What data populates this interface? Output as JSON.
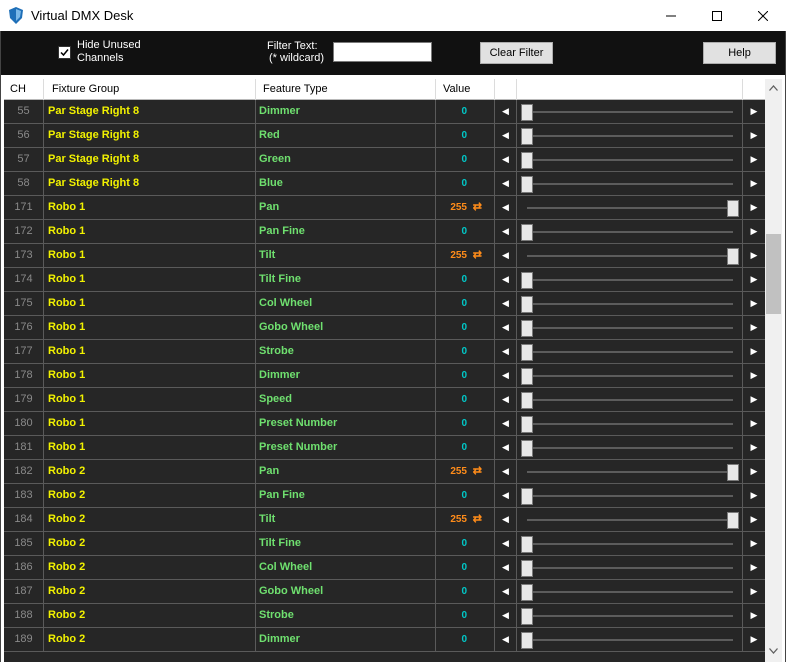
{
  "window": {
    "title": "Virtual DMX Desk",
    "app_icon": "shield-logo-icon",
    "controls": [
      "minimize-icon",
      "maximize-icon",
      "close-icon"
    ]
  },
  "toolbar": {
    "hide_unused_label": "Hide Unused Channels",
    "hide_unused_checked": true,
    "filter_label": "Filter Text:\n(* wildcard)",
    "filter_value": "",
    "clear_filter_label": "Clear Filter",
    "help_label": "Help"
  },
  "grid": {
    "columns": [
      "CH",
      "Fixture Group",
      "Feature Type",
      "Value"
    ],
    "colors": {
      "channel": "#8a8a8a",
      "fixture": "#f2f200",
      "feature": "#6fe06f",
      "value_zero": "#00c8c8",
      "value_full": "#ff8c1a",
      "background": "#262626"
    },
    "rows": [
      {
        "ch": "55",
        "fixture": "Par Stage Right 8",
        "feature": "Dimmer",
        "value": "0",
        "level": 0,
        "toggle": ""
      },
      {
        "ch": "56",
        "fixture": "Par Stage Right 8",
        "feature": "Red",
        "value": "0",
        "level": 0,
        "toggle": ""
      },
      {
        "ch": "57",
        "fixture": "Par Stage Right 8",
        "feature": "Green",
        "value": "0",
        "level": 0,
        "toggle": ""
      },
      {
        "ch": "58",
        "fixture": "Par Stage Right 8",
        "feature": "Blue",
        "value": "0",
        "level": 0,
        "toggle": ""
      },
      {
        "ch": "171",
        "fixture": "Robo 1",
        "feature": "Pan",
        "value": "255",
        "level": 1,
        "toggle": "⇄"
      },
      {
        "ch": "172",
        "fixture": "Robo 1",
        "feature": "Pan Fine",
        "value": "0",
        "level": 0,
        "toggle": ""
      },
      {
        "ch": "173",
        "fixture": "Robo 1",
        "feature": "Tilt",
        "value": "255",
        "level": 1,
        "toggle": "⇄"
      },
      {
        "ch": "174",
        "fixture": "Robo 1",
        "feature": "Tilt Fine",
        "value": "0",
        "level": 0,
        "toggle": ""
      },
      {
        "ch": "175",
        "fixture": "Robo 1",
        "feature": "Col Wheel",
        "value": "0",
        "level": 0,
        "toggle": ""
      },
      {
        "ch": "176",
        "fixture": "Robo 1",
        "feature": "Gobo Wheel",
        "value": "0",
        "level": 0,
        "toggle": ""
      },
      {
        "ch": "177",
        "fixture": "Robo 1",
        "feature": "Strobe",
        "value": "0",
        "level": 0,
        "toggle": ""
      },
      {
        "ch": "178",
        "fixture": "Robo 1",
        "feature": "Dimmer",
        "value": "0",
        "level": 0,
        "toggle": ""
      },
      {
        "ch": "179",
        "fixture": "Robo 1",
        "feature": "Speed",
        "value": "0",
        "level": 0,
        "toggle": ""
      },
      {
        "ch": "180",
        "fixture": "Robo 1",
        "feature": "Preset Number",
        "value": "0",
        "level": 0,
        "toggle": ""
      },
      {
        "ch": "181",
        "fixture": "Robo 1",
        "feature": "Preset Number",
        "value": "0",
        "level": 0,
        "toggle": ""
      },
      {
        "ch": "182",
        "fixture": "Robo 2",
        "feature": "Pan",
        "value": "255",
        "level": 1,
        "toggle": "⇄"
      },
      {
        "ch": "183",
        "fixture": "Robo 2",
        "feature": "Pan Fine",
        "value": "0",
        "level": 0,
        "toggle": ""
      },
      {
        "ch": "184",
        "fixture": "Robo 2",
        "feature": "Tilt",
        "value": "255",
        "level": 1,
        "toggle": "⇄"
      },
      {
        "ch": "185",
        "fixture": "Robo 2",
        "feature": "Tilt Fine",
        "value": "0",
        "level": 0,
        "toggle": ""
      },
      {
        "ch": "186",
        "fixture": "Robo 2",
        "feature": "Col Wheel",
        "value": "0",
        "level": 0,
        "toggle": ""
      },
      {
        "ch": "187",
        "fixture": "Robo 2",
        "feature": "Gobo Wheel",
        "value": "0",
        "level": 0,
        "toggle": ""
      },
      {
        "ch": "188",
        "fixture": "Robo 2",
        "feature": "Strobe",
        "value": "0",
        "level": 0,
        "toggle": ""
      },
      {
        "ch": "189",
        "fixture": "Robo 2",
        "feature": "Dimmer",
        "value": "0",
        "level": 0,
        "toggle": ""
      }
    ]
  },
  "scrollbar": {
    "up_icon": "scroll-up-arrow-icon",
    "down_icon": "scroll-down-arrow-icon"
  }
}
